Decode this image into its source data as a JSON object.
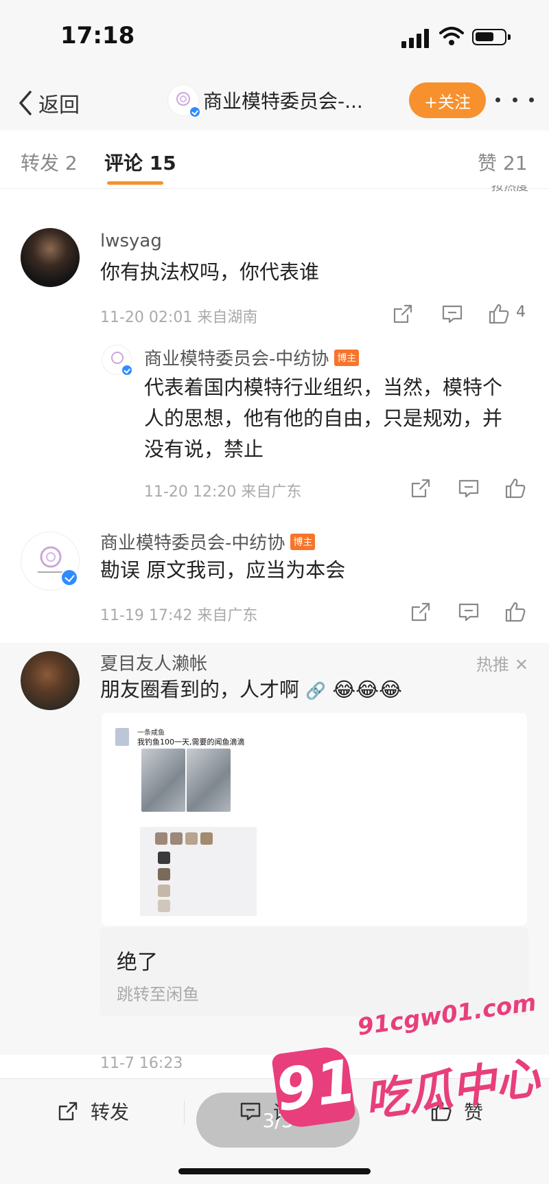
{
  "status_bar": {
    "time": "17:18"
  },
  "nav": {
    "back_label": "返回",
    "title": "商业模特委员会-...",
    "follow_label": "+关注"
  },
  "tabs": [
    {
      "label": "转发 2"
    },
    {
      "label": "评论 15"
    },
    {
      "label": "赞 21"
    }
  ],
  "sort_hint": "按热度",
  "comments": [
    {
      "username": "lwsyag",
      "text": "你有执法权吗，你代表谁",
      "time": "11-20 02:01",
      "location": "来自湖南",
      "likes": "4"
    },
    {
      "username": "商业模特委员会-中纺协",
      "badge": "博主",
      "text": "代表着国内模特行业组织，当然，模特个人的思想，他有他的自由，只是规劝，并没有说，禁止",
      "time": "11-20 12:20",
      "location": "来自广东"
    },
    {
      "username": "商业模特委员会-中纺协",
      "badge": "博主",
      "text": "勘误 原文我司，应当为本会",
      "time": "11-19 17:42",
      "location": "来自广东"
    },
    {
      "username": "夏目友人濑帐",
      "hot_label": "热推",
      "text": "朋友圈看到的，人才啊",
      "emoji": "😂😂😂",
      "time": "11-7 16:23",
      "image": {
        "post_author": "一条咸鱼",
        "post_text": "我钓鱼100一天,需要的闻鱼滴滴"
      },
      "quote": {
        "title": "绝了",
        "subtitle": "跳转至闲鱼"
      }
    }
  ],
  "bottom_bar": {
    "repost_label": "转发",
    "comment_label": "评论",
    "like_label": "赞",
    "pager": "3/3"
  },
  "watermark": {
    "domain": "91cgw01.com",
    "number": "91",
    "brand": "吃瓜中心"
  },
  "colors": {
    "accent_orange": "#f7912d",
    "verified_blue": "#2f8cff",
    "watermark_pink": "#e83e7c"
  }
}
